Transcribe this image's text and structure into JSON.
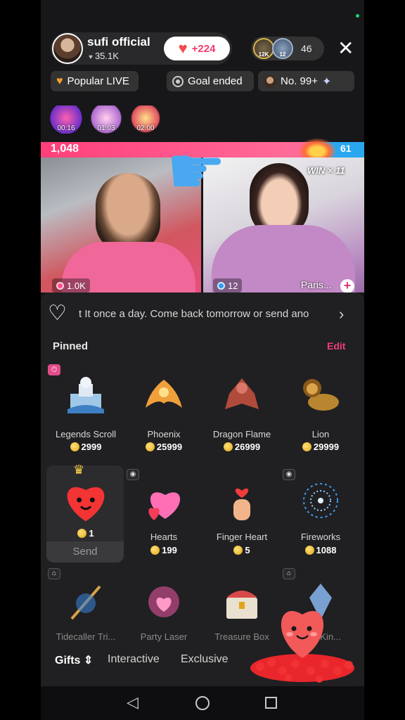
{
  "host": {
    "name": "sufi official",
    "likes": "35.1K",
    "like_gain": "+224"
  },
  "viewers": {
    "avatar_a_badge": "12K",
    "avatar_b_badge": "12",
    "count": "46"
  },
  "badges": {
    "popular": "Popular LIVE",
    "goal": "Goal ended",
    "rank": "No. 99+"
  },
  "effects": [
    {
      "time": "00:16"
    },
    {
      "time": "01:03"
    },
    {
      "time": "02:00"
    }
  ],
  "battle": {
    "left_score": "1,048",
    "right_score": "61",
    "win_label": "WIN × 11",
    "left_stat": "1.0K",
    "right_stat": "12",
    "opponent_name": "Paris...",
    "left_share": 0.85,
    "colors": {
      "left": "#ff3f7a",
      "right": "#2aa8ef"
    }
  },
  "notice": {
    "text": "t It once a day. Come back tomorrow or send ano"
  },
  "pinned": {
    "title": "Pinned",
    "edit": "Edit"
  },
  "gifts_row1": [
    {
      "name": "Legends Scroll",
      "price": "2999",
      "icon": "castle-icon"
    },
    {
      "name": "Phoenix",
      "price": "25999",
      "icon": "phoenix-icon"
    },
    {
      "name": "Dragon Flame",
      "price": "26999",
      "icon": "dragon-icon"
    },
    {
      "name": "Lion",
      "price": "29999",
      "icon": "lion-icon"
    }
  ],
  "gifts_row2": [
    {
      "name": "",
      "price": "1",
      "icon": "heart-face-icon",
      "send": "Send"
    },
    {
      "name": "Hearts",
      "price": "199",
      "icon": "hearts-icon"
    },
    {
      "name": "Finger Heart",
      "price": "5",
      "icon": "finger-heart-icon"
    },
    {
      "name": "Fireworks",
      "price": "1088",
      "icon": "fireworks-icon"
    }
  ],
  "gifts_row3": [
    {
      "name": "Tidecaller Tri...",
      "icon": "trident-icon"
    },
    {
      "name": "Party Laser",
      "icon": "laser-icon"
    },
    {
      "name": "Treasure Box",
      "icon": "treasure-box-icon"
    },
    {
      "name": "...ey Kin...",
      "icon": "crystal-icon"
    }
  ],
  "tabs": {
    "gifts": "Gifts",
    "interactive": "Interactive",
    "exclusive": "Exclusive"
  }
}
